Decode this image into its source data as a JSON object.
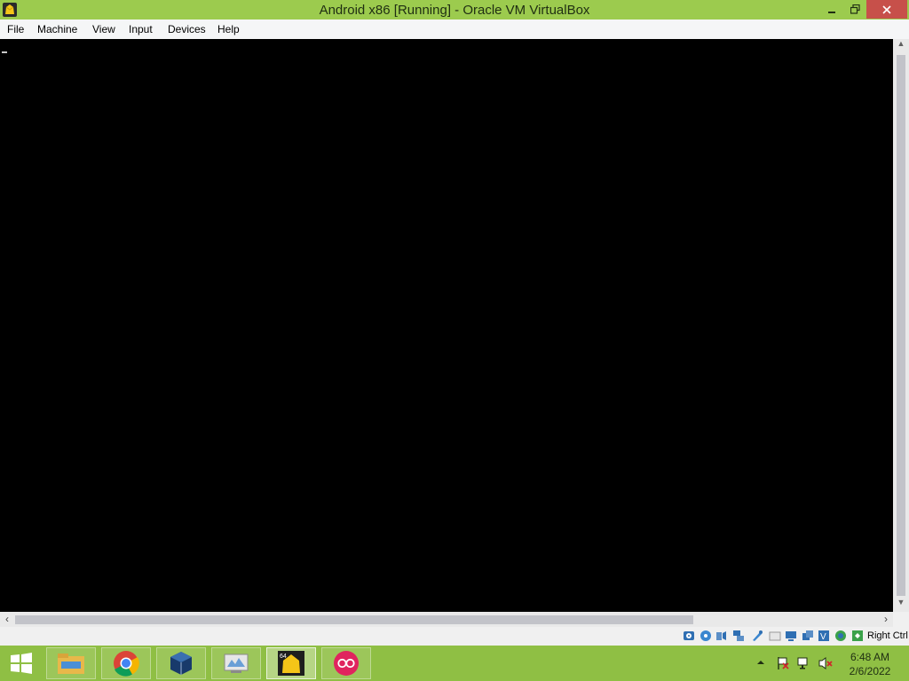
{
  "window": {
    "title": "Android x86 [Running] - Oracle VM VirtualBox",
    "title_bar_color": "#9ccb4e",
    "close_button_color": "#c7504a"
  },
  "menu": {
    "items": [
      "File",
      "Machine",
      "View",
      "Input",
      "Devices",
      "Help"
    ]
  },
  "vm_display": {
    "background": "#000000",
    "content": "_"
  },
  "status_bar": {
    "icons": [
      "hard-disk-icon",
      "optical-drive-icon",
      "audio-icon",
      "network-icon",
      "usb-icon",
      "shared-folders-icon",
      "display-icon",
      "video-capture-icon",
      "virtualization-icon",
      "mouse-integration-icon",
      "keyboard-capture-icon"
    ],
    "host_key": "Right Ctrl"
  },
  "taskbar": {
    "apps": [
      "file-explorer-icon",
      "chrome-icon",
      "virtualbox-icon",
      "virtualbox-manager-icon",
      "android-vm-icon",
      "record-app-icon"
    ],
    "active_app": "android-vm-icon",
    "clock": {
      "time": "6:48 AM",
      "date": "2/6/2022"
    },
    "tray_icons": [
      "show-hidden-icons-chevron",
      "action-center-icon",
      "network-icon",
      "volume-muted-icon"
    ]
  }
}
